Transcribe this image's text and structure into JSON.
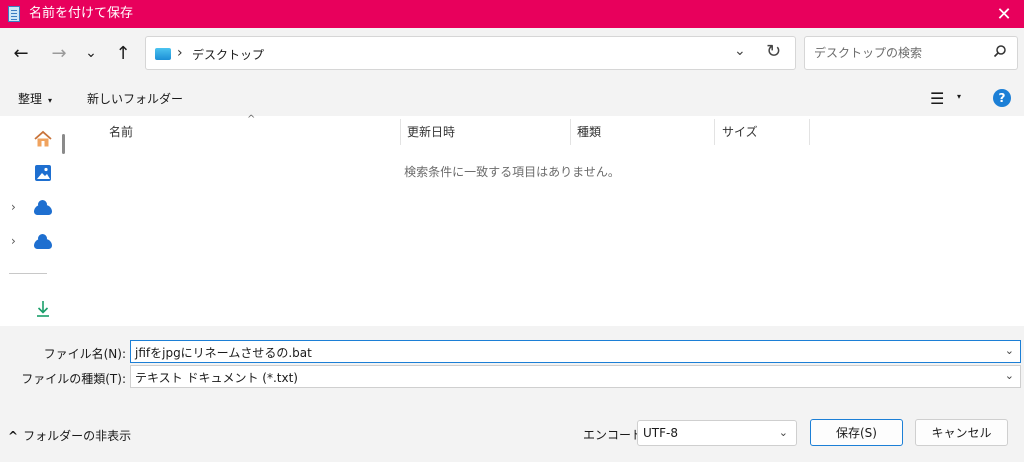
{
  "window": {
    "title": "名前を付けて保存",
    "close_glyph": "✕"
  },
  "nav": {
    "back": "←",
    "forward": "→",
    "recent": "⌄",
    "up": "↑"
  },
  "address": {
    "separator": "›",
    "crumb": "デスクトップ",
    "dropdown": "⌄",
    "refresh": "↻"
  },
  "search": {
    "placeholder": "デスクトップの検索"
  },
  "toolbar": {
    "organize": "整理",
    "organize_caret": "▾",
    "new_folder": "新しいフォルダー",
    "view_glyph": "☰",
    "view_caret": "▾",
    "help": "?"
  },
  "navpane": {
    "expander": "›",
    "items": [
      "home-icon",
      "gallery-icon",
      "onedrive-icon",
      "onedrive-icon",
      "downloads-icon"
    ]
  },
  "filelist": {
    "columns": [
      "名前",
      "更新日時",
      "種類",
      "サイズ"
    ],
    "sort_indicator": "^",
    "empty_message": "検索条件に一致する項目はありません。"
  },
  "form": {
    "filename_label": "ファイル名(N):",
    "filename_value": "jfifをjpgにリネームさせるの.bat",
    "filetype_label": "ファイルの種類(T):",
    "filetype_value": "テキスト ドキュメント (*.txt)",
    "chevron": "⌄"
  },
  "footer": {
    "toggle_label": "フォルダーの非表示",
    "toggle_glyph": "^",
    "encoding_label": "エンコード:",
    "encoding_value": "UTF-8",
    "save": "保存(S)",
    "cancel": "キャンセル"
  },
  "colors": {
    "titlebar": "#e8005c",
    "accent": "#1c7fd6"
  }
}
